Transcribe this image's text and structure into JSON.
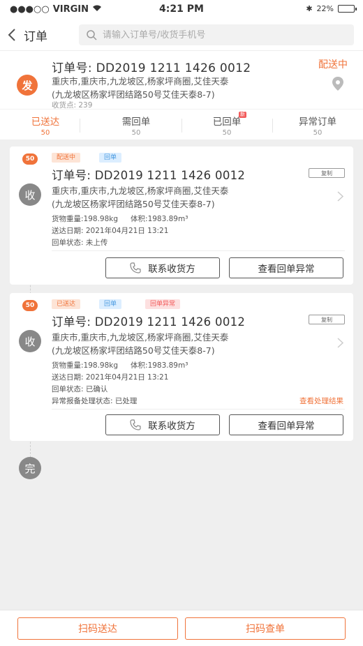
{
  "status_bar": {
    "carrier": "VIRGIN",
    "time": "4:21 PM",
    "battery": "22%"
  },
  "nav": {
    "title": "订单",
    "search_placeholder": "请输入订单号/收货手机号"
  },
  "current_order": {
    "badge": "发",
    "order_no": "订单号: DD2019 1211 1426 0012",
    "address_line1": "重庆市,重庆市,九龙坡区,杨家坪商圈,艾佳天泰",
    "address_line2": "(九龙坡区杨家坪团结路50号艾佳天泰8-7)",
    "points": "收货点: 239",
    "status": "配送中"
  },
  "tabs": [
    {
      "label": "已送达",
      "count": "50"
    },
    {
      "label": "需回单",
      "count": "50"
    },
    {
      "label": "已回单",
      "count": "50",
      "badge": "新"
    },
    {
      "label": "异常订单",
      "count": "50"
    }
  ],
  "cards": [
    {
      "num": "50",
      "badge": "收",
      "tags": [
        "配送中",
        "回单"
      ],
      "order_no": "订单号: DD2019 1211 1426 0012",
      "copy": "复制",
      "address_line1": "重庆市,重庆市,九龙坡区,杨家坪商圈,艾佳天泰",
      "address_line2": "(九龙坡区杨家坪团结路50号艾佳天泰8-7)",
      "weight": "货物重量:198.98kg",
      "volume": "体积:1983.89m³",
      "date": "送达日期: 2021年04月21日 13:21",
      "receipt_status": "回单状态: 未上传",
      "contact_btn": "联系收货方",
      "view_btn": "查看回单异常"
    },
    {
      "num": "50",
      "badge": "收",
      "tags": [
        "已送达",
        "回单",
        "回单异常"
      ],
      "order_no": "订单号: DD2019 1211 1426 0012",
      "copy": "复制",
      "address_line1": "重庆市,重庆市,九龙坡区,杨家坪商圈,艾佳天泰",
      "address_line2": "(九龙坡区杨家坪团结路50号艾佳天泰8-7)",
      "weight": "货物重量:198.98kg",
      "volume": "体积:1983.89m³",
      "date": "送达日期: 2021年04月21日 13:21",
      "receipt_status": "回单状态: 已确认",
      "exception_status": "异常报备处理状态: 已处理",
      "exception_link": "查看处理结果",
      "contact_btn": "联系收货方",
      "view_btn": "查看回单异常"
    }
  ],
  "end_badge": "完",
  "bottom": {
    "scan_deliver": "扫码送达",
    "scan_lookup": "扫码查单"
  },
  "colors": {
    "accent": "#f0733a",
    "blue_tag": "#4a9be0",
    "red_tag": "#f25a5a"
  }
}
